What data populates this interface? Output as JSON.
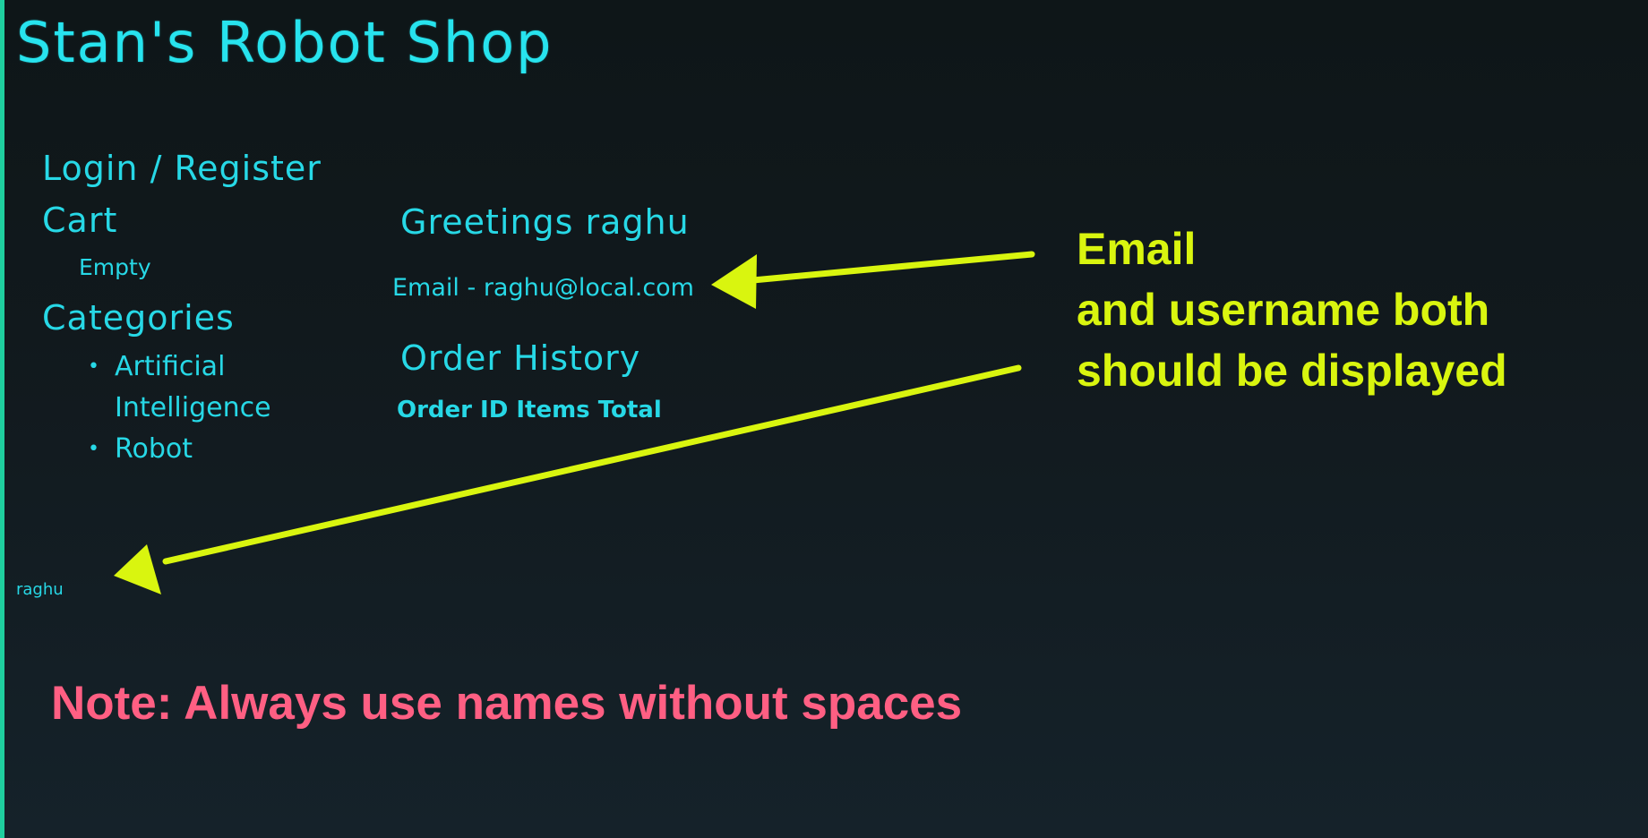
{
  "brand": {
    "title": "Stan's Robot Shop"
  },
  "nav": {
    "login_register": "Login / Register",
    "cart_title": "Cart",
    "cart_status": "Empty",
    "categories_title": "Categories",
    "categories": [
      "Artificial Intelligence",
      "Robot"
    ]
  },
  "main": {
    "greeting": "Greetings raghu",
    "email": "Email - raghu@local.com",
    "order_history_title": "Order History",
    "order_table_header": "Order ID Items Total"
  },
  "footer": {
    "username": "raghu"
  },
  "annotations": {
    "label_line1": "Email",
    "label_line2": "and username both",
    "label_line3": "should be displayed",
    "note": "Note: Always use names without spaces",
    "arrow_color": "#d9f50f",
    "note_color": "#ff5f83"
  },
  "theme": {
    "accent": "#27d8e6",
    "edge": "#1fcf9f",
    "background": "#11191d"
  }
}
